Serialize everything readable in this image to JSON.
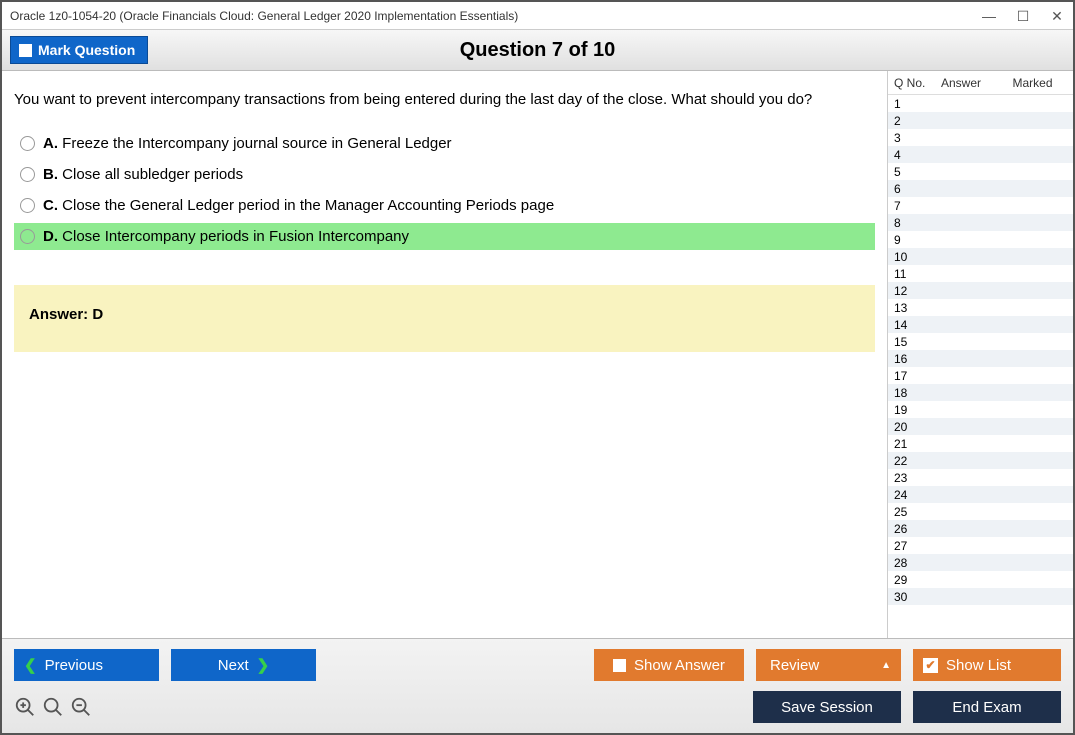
{
  "window": {
    "title": "Oracle 1z0-1054-20 (Oracle Financials Cloud: General Ledger 2020 Implementation Essentials)"
  },
  "header": {
    "mark_label": "Mark Question",
    "question_counter": "Question 7 of 10"
  },
  "question": {
    "text": "You want to prevent intercompany transactions from being entered during the last day of the close. What should you do?",
    "options": [
      {
        "letter": "A.",
        "text": "Freeze the Intercompany journal source in General Ledger",
        "highlight": false
      },
      {
        "letter": "B.",
        "text": "Close all subledger periods",
        "highlight": false
      },
      {
        "letter": "C.",
        "text": "Close the General Ledger period in the Manager Accounting Periods page",
        "highlight": false
      },
      {
        "letter": "D.",
        "text": "Close Intercompany periods in Fusion Intercompany",
        "highlight": true
      }
    ],
    "answer_label": "Answer: D"
  },
  "list": {
    "columns": {
      "qno": "Q No.",
      "answer": "Answer",
      "marked": "Marked"
    },
    "rows": [
      {
        "n": "1"
      },
      {
        "n": "2"
      },
      {
        "n": "3"
      },
      {
        "n": "4"
      },
      {
        "n": "5"
      },
      {
        "n": "6"
      },
      {
        "n": "7"
      },
      {
        "n": "8"
      },
      {
        "n": "9"
      },
      {
        "n": "10"
      },
      {
        "n": "11"
      },
      {
        "n": "12"
      },
      {
        "n": "13"
      },
      {
        "n": "14"
      },
      {
        "n": "15"
      },
      {
        "n": "16"
      },
      {
        "n": "17"
      },
      {
        "n": "18"
      },
      {
        "n": "19"
      },
      {
        "n": "20"
      },
      {
        "n": "21"
      },
      {
        "n": "22"
      },
      {
        "n": "23"
      },
      {
        "n": "24"
      },
      {
        "n": "25"
      },
      {
        "n": "26"
      },
      {
        "n": "27"
      },
      {
        "n": "28"
      },
      {
        "n": "29"
      },
      {
        "n": "30"
      }
    ]
  },
  "footer": {
    "previous": "Previous",
    "next": "Next",
    "show_answer": "Show Answer",
    "review": "Review",
    "show_list": "Show List",
    "save_session": "Save Session",
    "end_exam": "End Exam"
  }
}
